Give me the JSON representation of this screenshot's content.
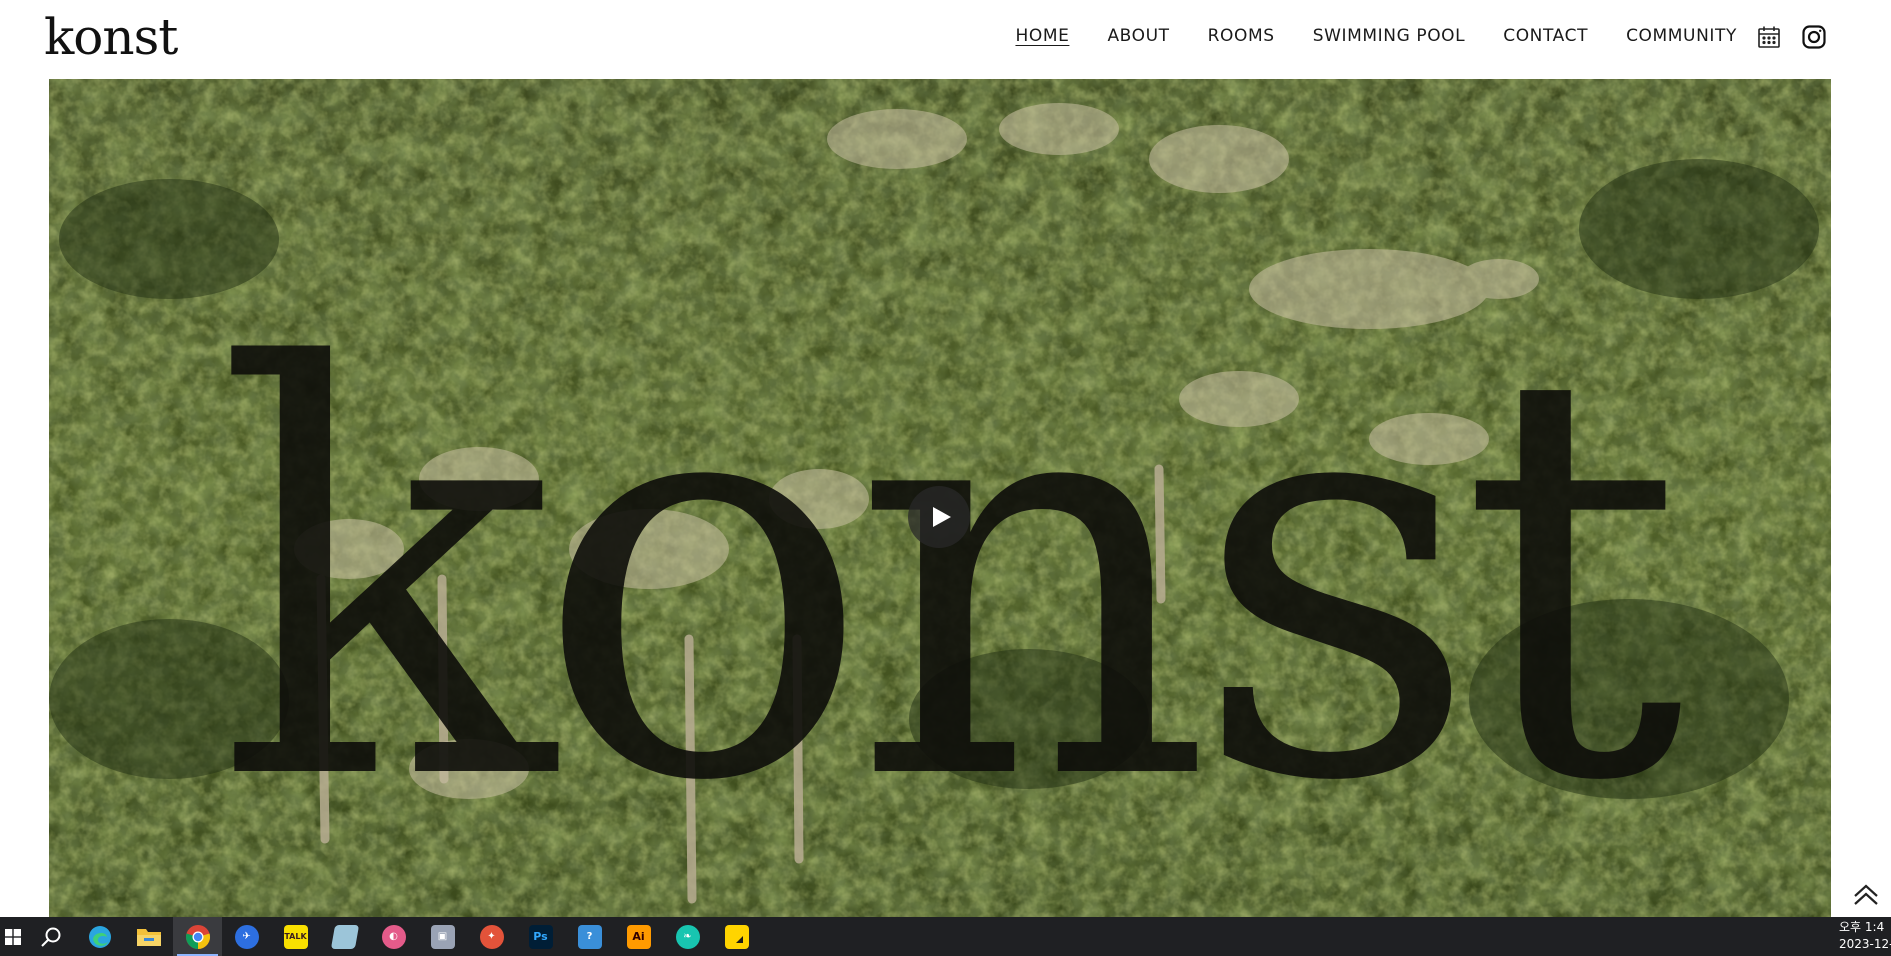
{
  "header": {
    "logo": "konst",
    "nav": [
      {
        "label": "HOME",
        "active": true
      },
      {
        "label": "ABOUT",
        "active": false
      },
      {
        "label": "ROOMS",
        "active": false
      },
      {
        "label": "SWIMMING POOL",
        "active": false
      },
      {
        "label": "CONTACT",
        "active": false
      },
      {
        "label": "COMMUNITY",
        "active": false
      }
    ],
    "icons": [
      "calendar-icon",
      "instagram-icon"
    ]
  },
  "hero": {
    "overlay_word": "konst",
    "media": "forest-with-palm-trees",
    "play_icon": "play-icon"
  },
  "scroll_top_icon": "double-chevron-up-icon",
  "taskbar": {
    "apps": [
      "windows-start-icon",
      "search-icon",
      "edge-icon",
      "file-explorer-icon",
      "chrome-icon",
      "app-icon",
      "kakaotalk-icon",
      "app-icon",
      "app-icon",
      "app-icon",
      "app-icon",
      "photoshop-icon",
      "app-icon",
      "illustrator-icon",
      "app-icon",
      "sticky-notes-icon"
    ],
    "kakaotalk_label": "TALK",
    "photoshop_label": "Ps",
    "illustrator_label": "Ai",
    "clock_time": "오후 1:4",
    "clock_date": "2023-12-"
  },
  "colors": {
    "header_bg": "#ffffff",
    "text": "#1a1a1a",
    "taskbar_bg": "#1f2023",
    "forest": "#43521f"
  }
}
